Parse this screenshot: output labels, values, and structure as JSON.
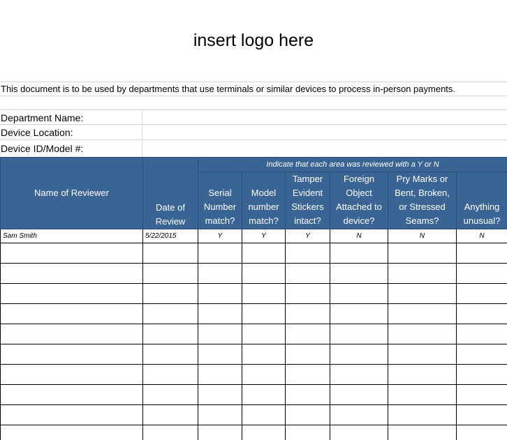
{
  "logo_placeholder": "insert logo here",
  "intro_text": "This document is to be used by departments  that use terminals or similar devices to process in-person payments.",
  "fields": {
    "department_label": "Department Name:",
    "location_label": "Device Location:",
    "device_label": "Device ID/Model #:"
  },
  "table": {
    "instruction": "Indicate that each area was reviewed with a Y or N",
    "headers": {
      "reviewer": "Name of Reviewer",
      "date": [
        "Date of",
        "Review"
      ],
      "serial": [
        "Serial",
        "Number",
        "match?"
      ],
      "model": [
        "Model",
        "number",
        "match?"
      ],
      "tamper": [
        "Tamper",
        "Evident",
        "Stickers",
        "intact?"
      ],
      "foreign": [
        "Foreign",
        "Object",
        "Attached to",
        "device?"
      ],
      "pry": [
        "Pry Marks or",
        "Bent, Broken,",
        "or Stressed",
        "Seams?"
      ],
      "unusual": [
        "Anything",
        "unusual?"
      ]
    },
    "rows": [
      [
        "Sam Smith",
        "5/22/2015",
        "Y",
        "Y",
        "Y",
        "N",
        "N",
        "N"
      ]
    ]
  },
  "colors": {
    "header_bg": "#3a6493",
    "header_text": "#ffffff"
  }
}
